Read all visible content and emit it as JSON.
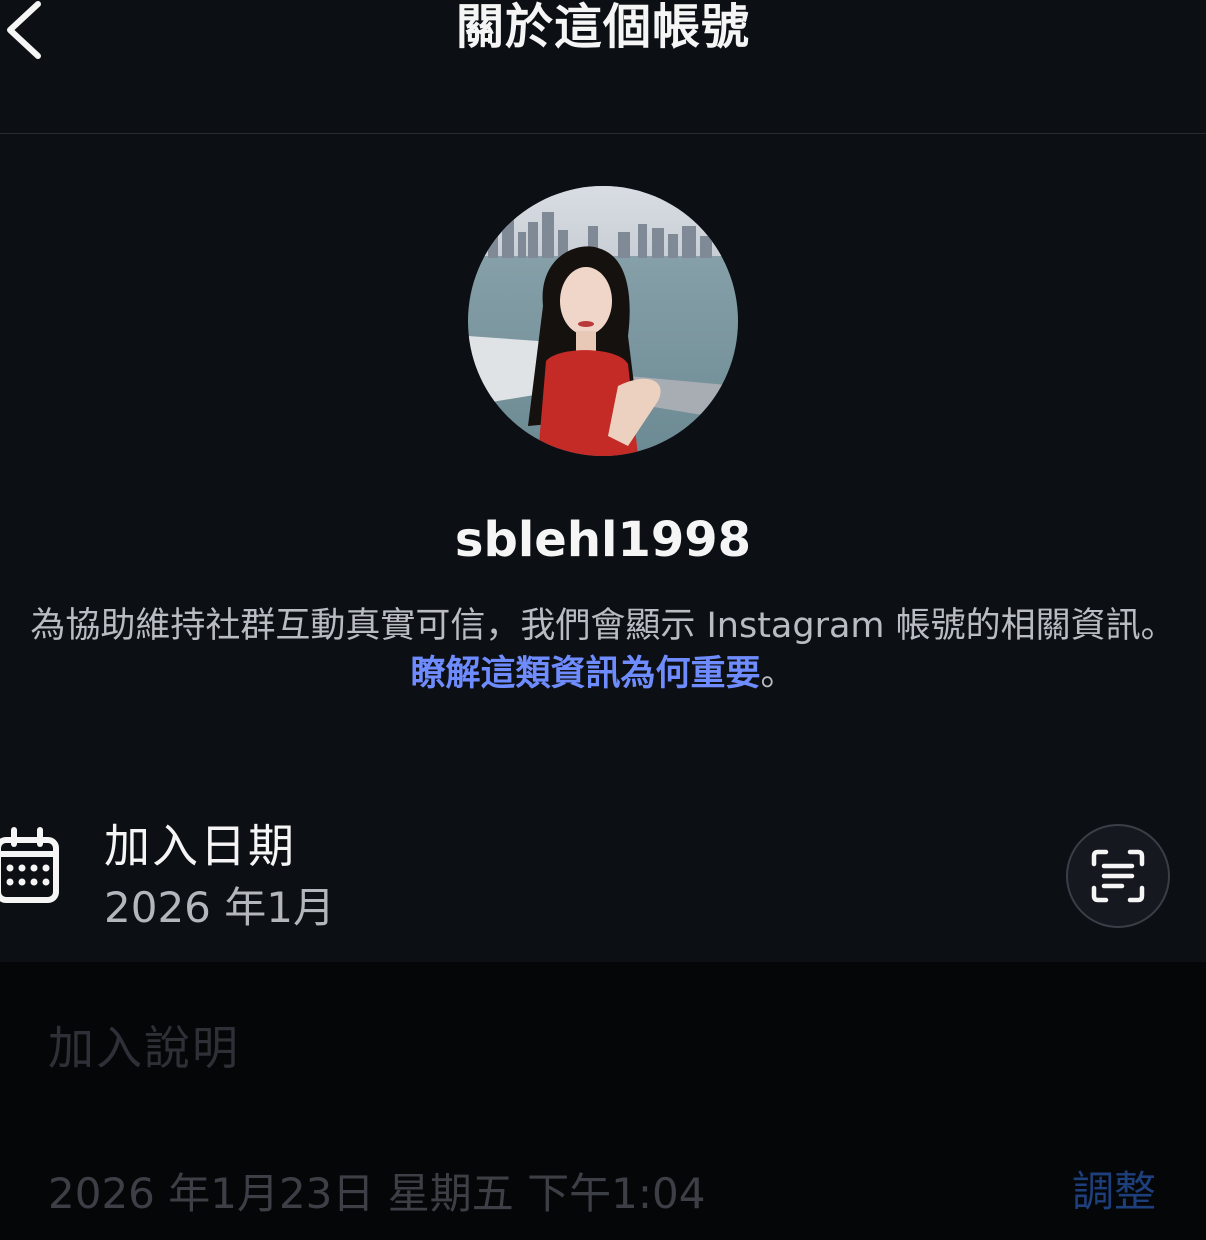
{
  "header": {
    "title": "關於這個帳號"
  },
  "profile": {
    "username": "sblehl1998",
    "description_text": "為協助維持社群互動真實可信，我們會顯示 Instagram 帳號的相關資訊。",
    "description_link": "瞭解這類資訊為何重要",
    "description_end": "。"
  },
  "joined": {
    "label": "加入日期",
    "value": "2026 年1月"
  },
  "composer": {
    "caption_placeholder": "加入說明",
    "timestamp": "2026 年1月23日 星期五 下午1:04",
    "adjust_label": "調整"
  },
  "colors": {
    "background": "#0c0f14",
    "link": "#6f8cff",
    "composer_background": "#050608",
    "adjust": "#1d3f7c"
  },
  "icons": [
    "chevron-left-icon",
    "calendar-icon",
    "scan-text-icon"
  ]
}
